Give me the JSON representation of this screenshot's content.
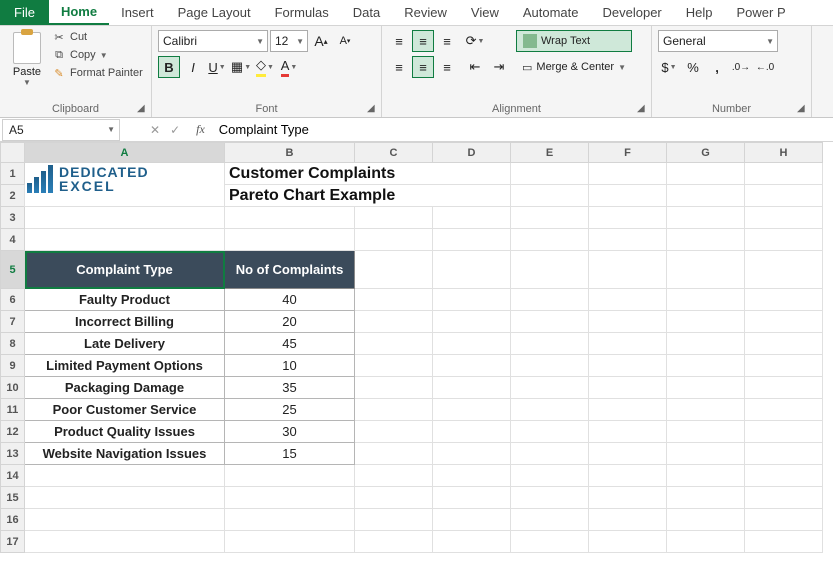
{
  "tabs": {
    "file": "File",
    "items": [
      "Home",
      "Insert",
      "Page Layout",
      "Formulas",
      "Data",
      "Review",
      "View",
      "Automate",
      "Developer",
      "Help",
      "Power P"
    ],
    "active": "Home"
  },
  "ribbon": {
    "clipboard": {
      "paste": "Paste",
      "cut": "Cut",
      "copy": "Copy",
      "format_painter": "Format Painter",
      "group_label": "Clipboard"
    },
    "font": {
      "family": "Calibri",
      "size": "12",
      "group_label": "Font"
    },
    "alignment": {
      "wrap_text": "Wrap Text",
      "merge_center": "Merge & Center",
      "group_label": "Alignment"
    },
    "number": {
      "format": "General",
      "group_label": "Number"
    }
  },
  "namebox": "A5",
  "formula": "Complaint Type",
  "columns": [
    "A",
    "B",
    "C",
    "D",
    "E",
    "F",
    "G",
    "H"
  ],
  "rows": [
    "1",
    "2",
    "3",
    "4",
    "5",
    "6",
    "7",
    "8",
    "9",
    "10",
    "11",
    "12",
    "13",
    "14",
    "15",
    "16",
    "17"
  ],
  "logo": {
    "line1": "DEDICATED",
    "line2": "EXCEL"
  },
  "titles": {
    "line1": "Customer Complaints",
    "line2": "Pareto Chart Example"
  },
  "table": {
    "header_a": "Complaint Type",
    "header_b": "No of Complaints",
    "rows": [
      {
        "label": "Faulty Product",
        "value": "40"
      },
      {
        "label": "Incorrect Billing",
        "value": "20"
      },
      {
        "label": "Late Delivery",
        "value": "45"
      },
      {
        "label": "Limited Payment Options",
        "value": "10"
      },
      {
        "label": "Packaging Damage",
        "value": "35"
      },
      {
        "label": "Poor Customer Service",
        "value": "25"
      },
      {
        "label": "Product Quality Issues",
        "value": "30"
      },
      {
        "label": "Website Navigation Issues",
        "value": "15"
      }
    ]
  },
  "chart_data": {
    "type": "table",
    "title": "Customer Complaints Pareto Chart Example",
    "columns": [
      "Complaint Type",
      "No of Complaints"
    ],
    "categories": [
      "Faulty Product",
      "Incorrect Billing",
      "Late Delivery",
      "Limited Payment Options",
      "Packaging Damage",
      "Poor Customer Service",
      "Product Quality Issues",
      "Website Navigation Issues"
    ],
    "values": [
      40,
      20,
      45,
      10,
      35,
      25,
      30,
      15
    ]
  }
}
